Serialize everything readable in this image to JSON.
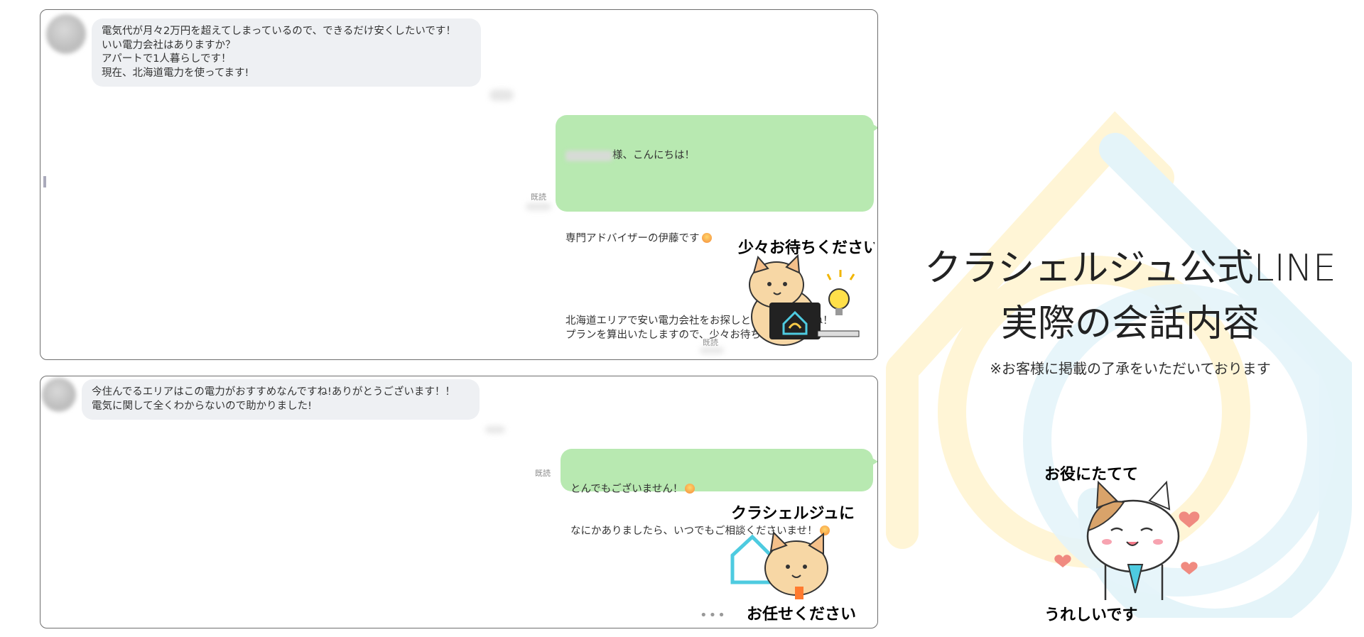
{
  "panel1": {
    "incoming_message": "電気代が月々2万円を超えてしまっているので、できるだけ安くしたいです！\nいい電力会社はありますか？\nアパートで1人暮らしです！\n現在、北海道電力を使ってます!",
    "reply_greeting_suffix": "様、こんにちは！",
    "reply_intro": "専門アドバイザーの伊藤です",
    "reply_body": "北海道エリアで安い電力会社をお探しということですね！\nプランを算出いたしますので、少々お待ちください！",
    "read_label_1": "既読",
    "sticker_text": "少々お待ちください",
    "read_label_2": "既読"
  },
  "panel2": {
    "incoming_message": "今住んでるエリアはこの電力がおすすめなんですね!ありがとうございます！！\n電気に関して全くわからないので助かりました!",
    "reply_line1": "とんでもございません！",
    "reply_line2": "なにかありましたら、いつでもご相談くださいませ！",
    "read_label": "既読",
    "sticker_text_top": "クラシェルジュに",
    "sticker_text_bottom": "お任せください",
    "typing_indicator": "•••"
  },
  "right": {
    "title_line1": "クラシェルジュ公式LINE",
    "title_line2": "実際の会話内容",
    "note": "※お客様に掲載の了承をいただいております",
    "sticker_text_top": "お役にたてて",
    "sticker_text_bottom": "うれしいです"
  },
  "colors": {
    "bubble_out": "#b8e9b1",
    "bubble_in": "#eef0f3",
    "logo_yellow": "#fff5d6",
    "logo_blue": "#e4f4f9"
  },
  "icons": [
    "avatar-icon",
    "emoji-icon",
    "cat-sticker",
    "house-logo"
  ]
}
